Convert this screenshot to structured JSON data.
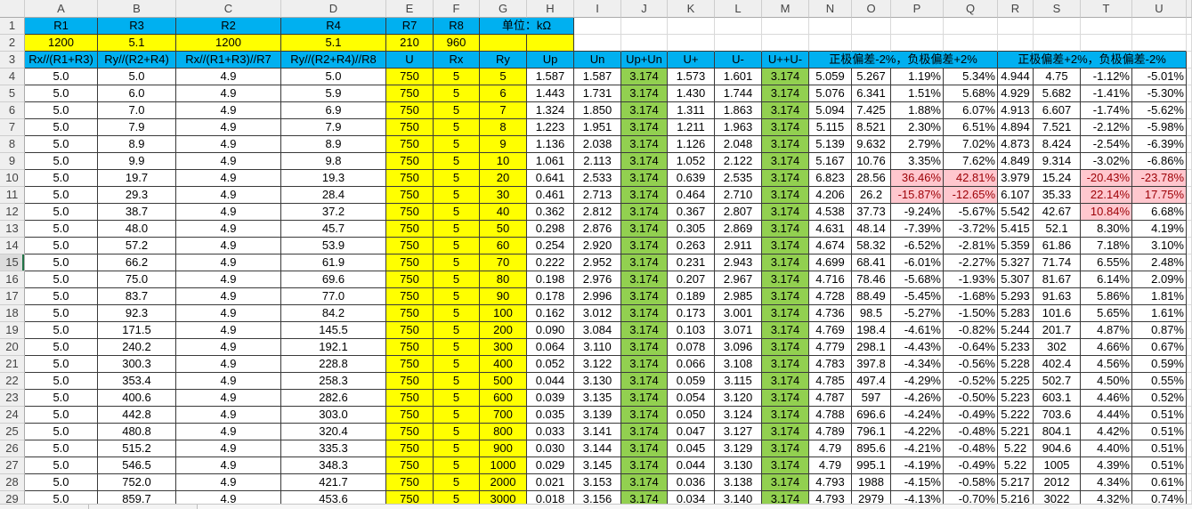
{
  "column_headers": [
    "A",
    "B",
    "C",
    "D",
    "E",
    "F",
    "G",
    "H",
    "I",
    "J",
    "K",
    "L",
    "M",
    "N",
    "O",
    "P",
    "Q",
    "R",
    "S",
    "T",
    "U"
  ],
  "row_headers": [
    "1",
    "2",
    "3",
    "4",
    "5",
    "6",
    "7",
    "8",
    "9",
    "10",
    "11",
    "12",
    "13",
    "14",
    "15",
    "16",
    "17",
    "18",
    "19",
    "20",
    "21",
    "22",
    "23",
    "24",
    "25",
    "26",
    "27",
    "28",
    "29"
  ],
  "active_row": 15,
  "colors": {
    "header_fill": "#00B0F0",
    "input_fill": "#FFFF00",
    "sum_fill": "#92D050",
    "alert_fill": "#FFC7CE",
    "alert_text": "#9C0006",
    "active_row_marker": "#217346"
  },
  "data_column_fills": [
    null,
    null,
    null,
    null,
    "#FFFF00",
    "#FFFF00",
    "#FFFF00",
    null,
    null,
    "#92D050",
    null,
    null,
    "#92D050",
    null,
    null,
    null,
    null,
    null,
    null,
    null,
    null
  ],
  "header_rows": {
    "row1": {
      "cells": [
        "R1",
        "R3",
        "R2",
        "R4",
        "R7",
        "R8"
      ],
      "unit_label": "单位：kΩ"
    },
    "row2": {
      "cells": [
        "1200",
        "5.1",
        "1200",
        "5.1",
        "210",
        "960"
      ]
    },
    "row3": {
      "cells": [
        "Rx//(R1+R3)",
        "Ry//(R2+R4)",
        "Rx//(R1+R3)//R7",
        "Ry//(R2+R4)//R8",
        "U",
        "Rx",
        "Ry",
        "Up",
        "Un",
        "Up+Un",
        "U+",
        "U-",
        "U++U-"
      ],
      "deviation_group_1": "正极偏差-2%，负极偏差+2%",
      "deviation_group_2": "正极偏差+2%，负极偏差-2%"
    }
  },
  "data_rows": [
    [
      "5.0",
      "5.0",
      "4.9",
      "5.0",
      "750",
      "5",
      "5",
      "1.587",
      "1.587",
      "3.174",
      "1.573",
      "1.601",
      "3.174",
      "5.059",
      "5.267",
      "1.19%",
      "5.34%",
      "4.944",
      "4.75",
      "-1.12%",
      "-5.01%"
    ],
    [
      "5.0",
      "6.0",
      "4.9",
      "5.9",
      "750",
      "5",
      "6",
      "1.443",
      "1.731",
      "3.174",
      "1.430",
      "1.744",
      "3.174",
      "5.076",
      "6.341",
      "1.51%",
      "5.68%",
      "4.929",
      "5.682",
      "-1.41%",
      "-5.30%"
    ],
    [
      "5.0",
      "7.0",
      "4.9",
      "6.9",
      "750",
      "5",
      "7",
      "1.324",
      "1.850",
      "3.174",
      "1.311",
      "1.863",
      "3.174",
      "5.094",
      "7.425",
      "1.88%",
      "6.07%",
      "4.913",
      "6.607",
      "-1.74%",
      "-5.62%"
    ],
    [
      "5.0",
      "7.9",
      "4.9",
      "7.9",
      "750",
      "5",
      "8",
      "1.223",
      "1.951",
      "3.174",
      "1.211",
      "1.963",
      "3.174",
      "5.115",
      "8.521",
      "2.30%",
      "6.51%",
      "4.894",
      "7.521",
      "-2.12%",
      "-5.98%"
    ],
    [
      "5.0",
      "8.9",
      "4.9",
      "8.9",
      "750",
      "5",
      "9",
      "1.136",
      "2.038",
      "3.174",
      "1.126",
      "2.048",
      "3.174",
      "5.139",
      "9.632",
      "2.79%",
      "7.02%",
      "4.873",
      "8.424",
      "-2.54%",
      "-6.39%"
    ],
    [
      "5.0",
      "9.9",
      "4.9",
      "9.8",
      "750",
      "5",
      "10",
      "1.061",
      "2.113",
      "3.174",
      "1.052",
      "2.122",
      "3.174",
      "5.167",
      "10.76",
      "3.35%",
      "7.62%",
      "4.849",
      "9.314",
      "-3.02%",
      "-6.86%"
    ],
    [
      "5.0",
      "19.7",
      "4.9",
      "19.3",
      "750",
      "5",
      "20",
      "0.641",
      "2.533",
      "3.174",
      "0.639",
      "2.535",
      "3.174",
      "6.823",
      "28.56",
      {
        "value": "36.46%",
        "highlight": true
      },
      {
        "value": "42.81%",
        "highlight": true
      },
      "3.979",
      "15.24",
      {
        "value": "-20.43%",
        "highlight": true
      },
      {
        "value": "-23.78%",
        "highlight": true
      }
    ],
    [
      "5.0",
      "29.3",
      "4.9",
      "28.4",
      "750",
      "5",
      "30",
      "0.461",
      "2.713",
      "3.174",
      "0.464",
      "2.710",
      "3.174",
      "4.206",
      "26.2",
      {
        "value": "-15.87%",
        "highlight": true
      },
      {
        "value": "-12.65%",
        "highlight": true
      },
      "6.107",
      "35.33",
      {
        "value": "22.14%",
        "highlight": true
      },
      {
        "value": "17.75%",
        "highlight": true
      }
    ],
    [
      "5.0",
      "38.7",
      "4.9",
      "37.2",
      "750",
      "5",
      "40",
      "0.362",
      "2.812",
      "3.174",
      "0.367",
      "2.807",
      "3.174",
      "4.538",
      "37.73",
      "-9.24%",
      "-5.67%",
      "5.542",
      "42.67",
      {
        "value": "10.84%",
        "highlight": true
      },
      "6.68%"
    ],
    [
      "5.0",
      "48.0",
      "4.9",
      "45.7",
      "750",
      "5",
      "50",
      "0.298",
      "2.876",
      "3.174",
      "0.305",
      "2.869",
      "3.174",
      "4.631",
      "48.14",
      "-7.39%",
      "-3.72%",
      "5.415",
      "52.1",
      "8.30%",
      "4.19%"
    ],
    [
      "5.0",
      "57.2",
      "4.9",
      "53.9",
      "750",
      "5",
      "60",
      "0.254",
      "2.920",
      "3.174",
      "0.263",
      "2.911",
      "3.174",
      "4.674",
      "58.32",
      "-6.52%",
      "-2.81%",
      "5.359",
      "61.86",
      "7.18%",
      "3.10%"
    ],
    [
      "5.0",
      "66.2",
      "4.9",
      "61.9",
      "750",
      "5",
      "70",
      "0.222",
      "2.952",
      "3.174",
      "0.231",
      "2.943",
      "3.174",
      "4.699",
      "68.41",
      "-6.01%",
      "-2.27%",
      "5.327",
      "71.74",
      "6.55%",
      "2.48%"
    ],
    [
      "5.0",
      "75.0",
      "4.9",
      "69.6",
      "750",
      "5",
      "80",
      "0.198",
      "2.976",
      "3.174",
      "0.207",
      "2.967",
      "3.174",
      "4.716",
      "78.46",
      "-5.68%",
      "-1.93%",
      "5.307",
      "81.67",
      "6.14%",
      "2.09%"
    ],
    [
      "5.0",
      "83.7",
      "4.9",
      "77.0",
      "750",
      "5",
      "90",
      "0.178",
      "2.996",
      "3.174",
      "0.189",
      "2.985",
      "3.174",
      "4.728",
      "88.49",
      "-5.45%",
      "-1.68%",
      "5.293",
      "91.63",
      "5.86%",
      "1.81%"
    ],
    [
      "5.0",
      "92.3",
      "4.9",
      "84.2",
      "750",
      "5",
      "100",
      "0.162",
      "3.012",
      "3.174",
      "0.173",
      "3.001",
      "3.174",
      "4.736",
      "98.5",
      "-5.27%",
      "-1.50%",
      "5.283",
      "101.6",
      "5.65%",
      "1.61%"
    ],
    [
      "5.0",
      "171.5",
      "4.9",
      "145.5",
      "750",
      "5",
      "200",
      "0.090",
      "3.084",
      "3.174",
      "0.103",
      "3.071",
      "3.174",
      "4.769",
      "198.4",
      "-4.61%",
      "-0.82%",
      "5.244",
      "201.7",
      "4.87%",
      "0.87%"
    ],
    [
      "5.0",
      "240.2",
      "4.9",
      "192.1",
      "750",
      "5",
      "300",
      "0.064",
      "3.110",
      "3.174",
      "0.078",
      "3.096",
      "3.174",
      "4.779",
      "298.1",
      "-4.43%",
      "-0.64%",
      "5.233",
      "302",
      "4.66%",
      "0.67%"
    ],
    [
      "5.0",
      "300.3",
      "4.9",
      "228.8",
      "750",
      "5",
      "400",
      "0.052",
      "3.122",
      "3.174",
      "0.066",
      "3.108",
      "3.174",
      "4.783",
      "397.8",
      "-4.34%",
      "-0.56%",
      "5.228",
      "402.4",
      "4.56%",
      "0.59%"
    ],
    [
      "5.0",
      "353.4",
      "4.9",
      "258.3",
      "750",
      "5",
      "500",
      "0.044",
      "3.130",
      "3.174",
      "0.059",
      "3.115",
      "3.174",
      "4.785",
      "497.4",
      "-4.29%",
      "-0.52%",
      "5.225",
      "502.7",
      "4.50%",
      "0.55%"
    ],
    [
      "5.0",
      "400.6",
      "4.9",
      "282.6",
      "750",
      "5",
      "600",
      "0.039",
      "3.135",
      "3.174",
      "0.054",
      "3.120",
      "3.174",
      "4.787",
      "597",
      "-4.26%",
      "-0.50%",
      "5.223",
      "603.1",
      "4.46%",
      "0.52%"
    ],
    [
      "5.0",
      "442.8",
      "4.9",
      "303.0",
      "750",
      "5",
      "700",
      "0.035",
      "3.139",
      "3.174",
      "0.050",
      "3.124",
      "3.174",
      "4.788",
      "696.6",
      "-4.24%",
      "-0.49%",
      "5.222",
      "703.6",
      "4.44%",
      "0.51%"
    ],
    [
      "5.0",
      "480.8",
      "4.9",
      "320.4",
      "750",
      "5",
      "800",
      "0.033",
      "3.141",
      "3.174",
      "0.047",
      "3.127",
      "3.174",
      "4.789",
      "796.1",
      "-4.22%",
      "-0.48%",
      "5.221",
      "804.1",
      "4.42%",
      "0.51%"
    ],
    [
      "5.0",
      "515.2",
      "4.9",
      "335.3",
      "750",
      "5",
      "900",
      "0.030",
      "3.144",
      "3.174",
      "0.045",
      "3.129",
      "3.174",
      "4.79",
      "895.6",
      "-4.21%",
      "-0.48%",
      "5.22",
      "904.6",
      "4.40%",
      "0.51%"
    ],
    [
      "5.0",
      "546.5",
      "4.9",
      "348.3",
      "750",
      "5",
      "1000",
      "0.029",
      "3.145",
      "3.174",
      "0.044",
      "3.130",
      "3.174",
      "4.79",
      "995.1",
      "-4.19%",
      "-0.49%",
      "5.22",
      "1005",
      "4.39%",
      "0.51%"
    ],
    [
      "5.0",
      "752.0",
      "4.9",
      "421.7",
      "750",
      "5",
      "2000",
      "0.021",
      "3.153",
      "3.174",
      "0.036",
      "3.138",
      "3.174",
      "4.793",
      "1988",
      "-4.15%",
      "-0.58%",
      "5.217",
      "2012",
      "4.34%",
      "0.61%"
    ],
    [
      "5.0",
      "859.7",
      "4.9",
      "453.6",
      "750",
      "5",
      "3000",
      "0.018",
      "3.156",
      "3.174",
      "0.034",
      "3.140",
      "3.174",
      "4.793",
      "2979",
      "-4.13%",
      "-0.70%",
      "5.216",
      "3022",
      "4.32%",
      "0.74%"
    ]
  ]
}
